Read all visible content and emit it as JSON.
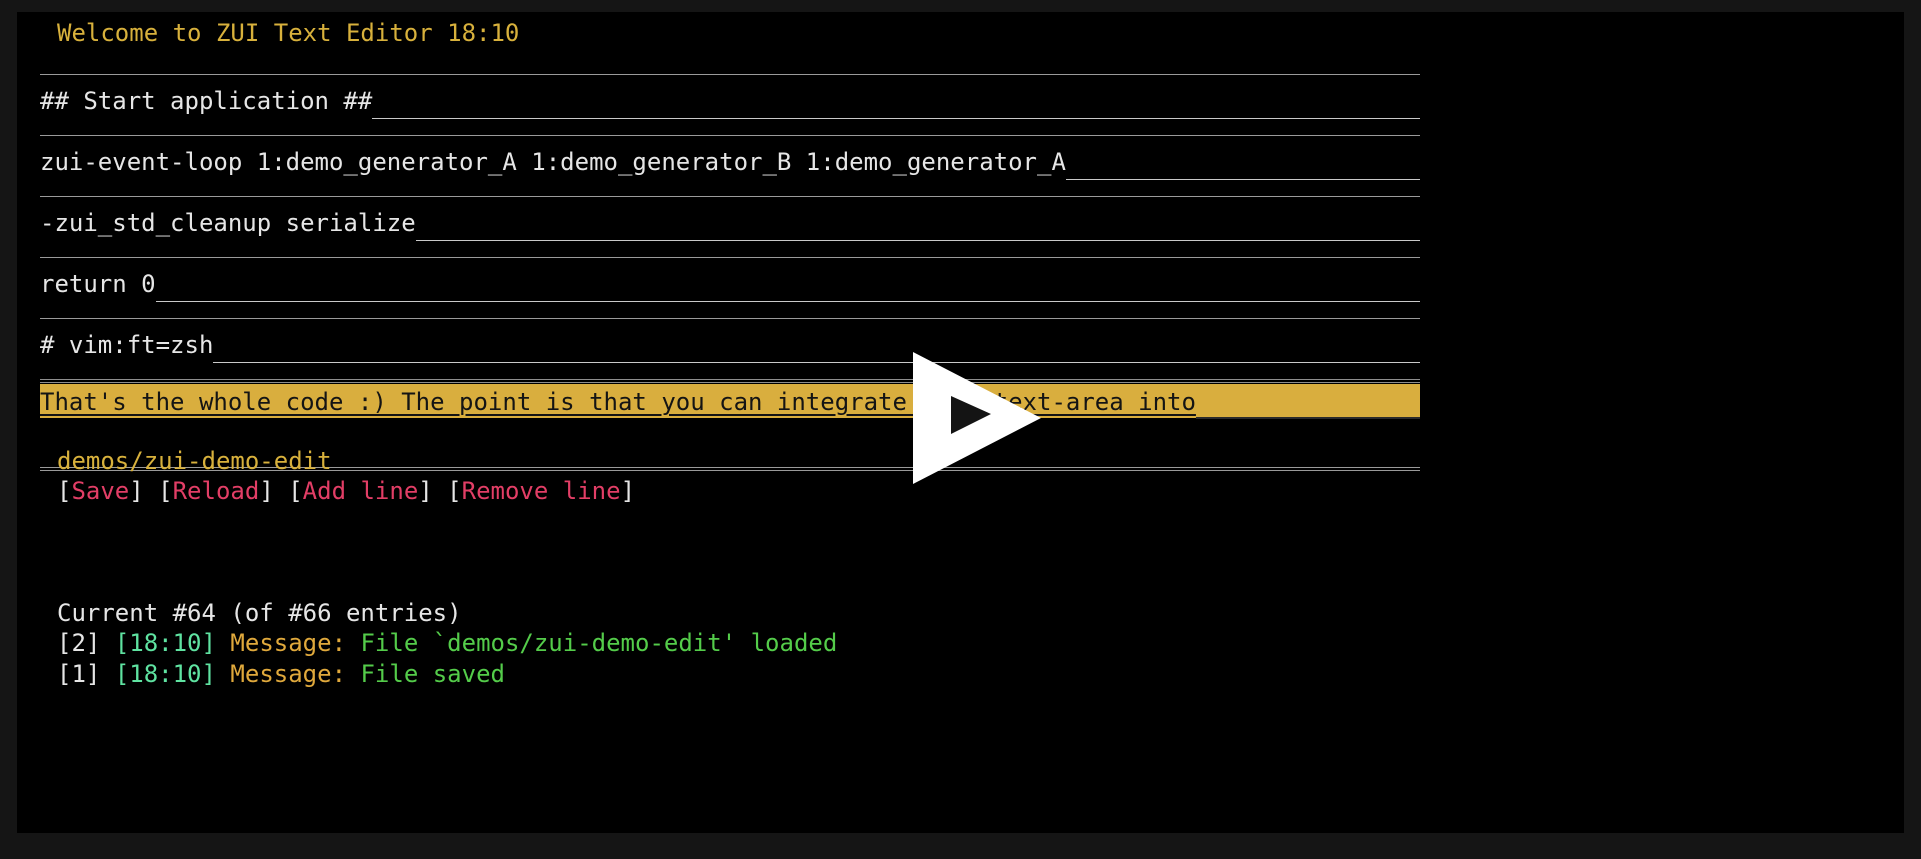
{
  "app": {
    "title": "Welcome to ZUI Text Editor 18:10",
    "title_color": "#d8b13c",
    "background": "#000000",
    "frame_background": "#151515"
  },
  "editor": {
    "name": "zui-text-area",
    "highlight_color": "#d9ae3e",
    "text_color": "#e6e6e6",
    "rule_color": "#9a9a9a",
    "lines": [
      {
        "text": "## Start application ##",
        "selected": false
      },
      {
        "text": "zui-event-loop 1:demo_generator_A 1:demo_generator_B 1:demo_generator_A",
        "selected": false
      },
      {
        "text": "-zui_std_cleanup serialize",
        "selected": false
      },
      {
        "text": "return 0",
        "selected": false
      },
      {
        "text": "# vim:ft=zsh",
        "selected": false
      },
      {
        "text": "That's the whole code :) The point is that you can integrate such text-area into",
        "selected": true
      }
    ]
  },
  "file": {
    "path": "demos/zui-demo-edit",
    "path_color": "#d8b13c"
  },
  "buttons": {
    "bracket_open": "[",
    "bracket_close": "]",
    "separator": " ",
    "color": "#e23e66",
    "items": [
      {
        "label": "Save",
        "name": "save-button"
      },
      {
        "label": "Reload",
        "name": "reload-button"
      },
      {
        "label": "Add line",
        "name": "add-line-button"
      },
      {
        "label": "Remove line",
        "name": "remove-line-button"
      }
    ]
  },
  "status": {
    "current_text": "Current #64 (of #66 entries)",
    "current_entry": 64,
    "total_entries": 66
  },
  "log": {
    "entries": [
      {
        "index": "[2]",
        "time": "[18:10]",
        "kind": "Message:",
        "message": "File `demos/zui-demo-edit' loaded"
      },
      {
        "index": "[1]",
        "time": "[18:10]",
        "kind": "Message:",
        "message": "File saved"
      }
    ],
    "index_color": "#e6e6e6",
    "time_color": "#5fe3a1",
    "kind_color": "#e0a93c",
    "message_color": "#54cc4a"
  },
  "overlay": {
    "play_label": "Play",
    "icon": "play-triangle-icon",
    "color": "#ffffff"
  }
}
